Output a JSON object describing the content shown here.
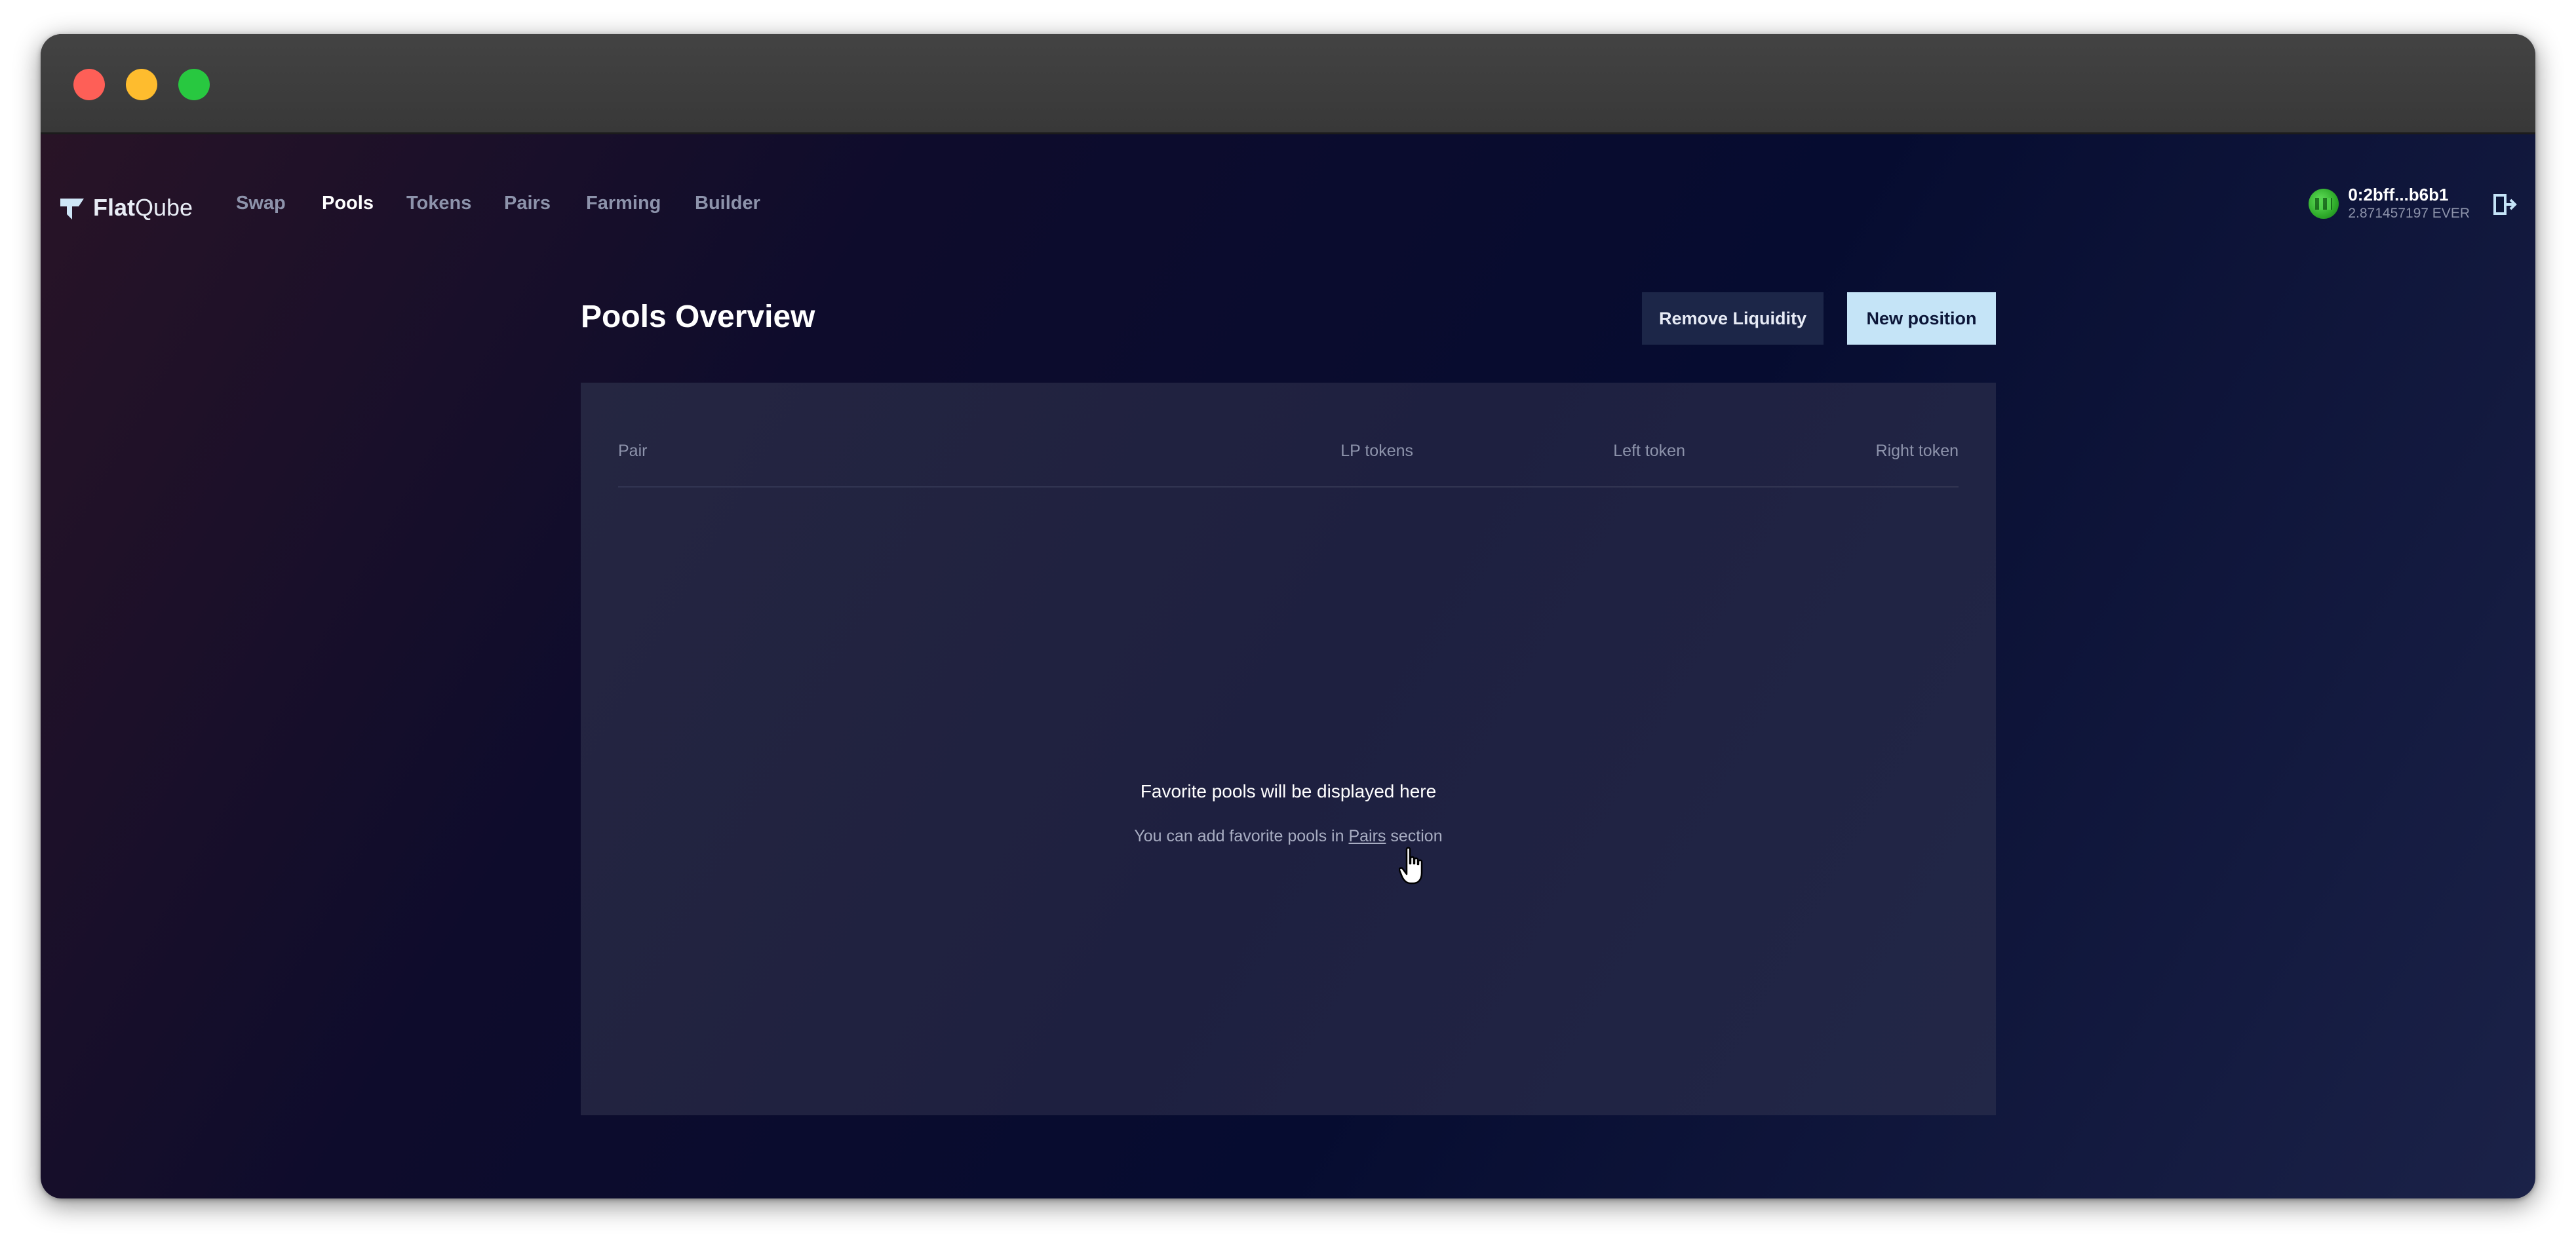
{
  "window": {
    "traffic_lights": [
      "close",
      "minimize",
      "zoom"
    ]
  },
  "brand": {
    "name_bold": "Flat",
    "name_light": "Qube"
  },
  "nav": {
    "items": [
      {
        "label": "Swap",
        "active": false
      },
      {
        "label": "Pools",
        "active": true
      },
      {
        "label": "Tokens",
        "active": false
      },
      {
        "label": "Pairs",
        "active": false
      },
      {
        "label": "Farming",
        "active": false
      },
      {
        "label": "Builder",
        "active": false
      }
    ]
  },
  "wallet": {
    "address": "0:2bff...b6b1",
    "balance": "2.871457197 EVER"
  },
  "page": {
    "title": "Pools Overview",
    "remove_liquidity_label": "Remove Liquidity",
    "new_position_label": "New position"
  },
  "table": {
    "columns": [
      "Pair",
      "LP tokens",
      "Left token",
      "Right token"
    ]
  },
  "empty_state": {
    "title": "Favorite pools will be displayed here",
    "sub_before": "You can add favorite pools in ",
    "link": "Pairs",
    "sub_after": " section"
  },
  "colors": {
    "accent_button": "#c5e4f7",
    "secondary_button": "#1c2648",
    "active_nav": "#ffffff",
    "muted_text": "#8d93ab"
  }
}
